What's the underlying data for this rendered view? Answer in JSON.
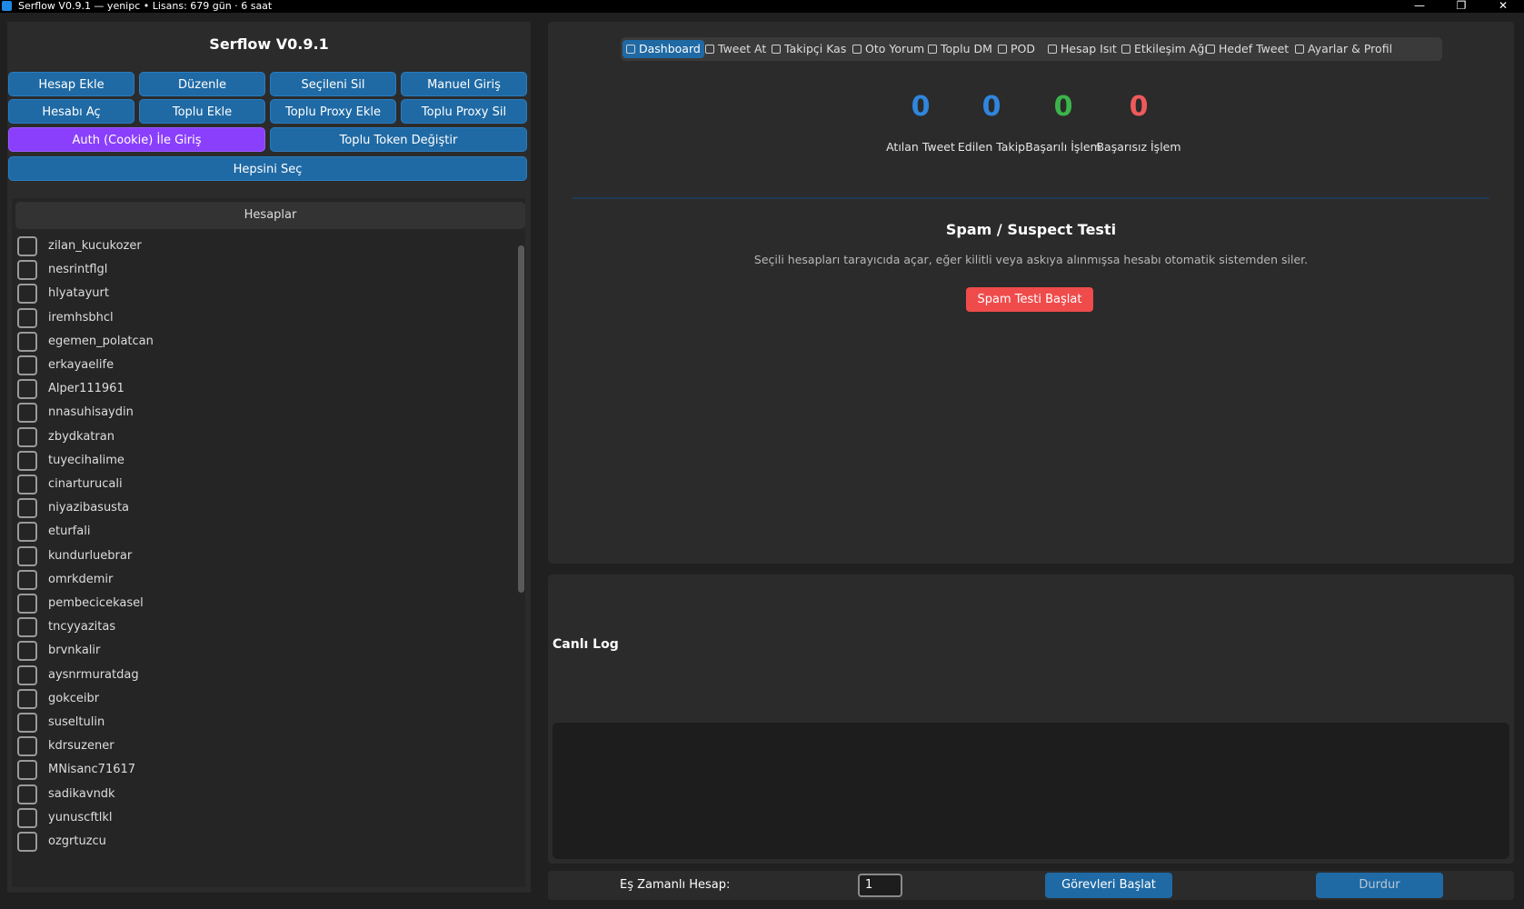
{
  "window": {
    "title": "Serflow V0.9.1 — yenipc  •  Lisans: 679 gün · 6 saat",
    "controls": [
      "—",
      "❐",
      "✕"
    ]
  },
  "sidebar": {
    "app_title": "Serflow V0.9.1",
    "buttons": {
      "hesap_ekle": "Hesap Ekle",
      "duzenle": "Düzenle",
      "secileni_sil": "Seçileni Sil",
      "manuel_giris": "Manuel Giriş",
      "hesabi_ac": "Hesabı Aç",
      "toplu_ekle": "Toplu Ekle",
      "toplu_proxy_ekle": "Toplu Proxy Ekle",
      "toplu_proxy_sil": "Toplu Proxy Sil",
      "auth_giris": "Auth (Cookie) İle Giriş",
      "toplu_token": "Toplu Token Değiştir",
      "hepsini_sec": "Hepsini Seç"
    },
    "accounts_header": "Hesaplar",
    "accounts": [
      "zilan_kucukozer",
      "nesrintflgl",
      "hlyatayurt",
      "iremhsbhcl",
      "egemen_polatcan",
      "erkayaelife",
      "Alper111961",
      "nnasuhisaydin",
      "zbydkatran",
      "tuyecihalime",
      "cinarturucali",
      "niyazibasusta",
      "eturfali",
      "kundurluebrar",
      "omrkdemir",
      "pembecicekasel",
      "tncyyazitas",
      "brvnkalir",
      "aysnrmuratdag",
      "gokceibr",
      "suseltulin",
      "kdrsuzener",
      "MNisanc71617",
      "sadikavndk",
      "yunuscftlkl",
      "ozgrtuzcu"
    ]
  },
  "tabs": [
    {
      "label": "Dashboard",
      "icon": "dashboard-icon",
      "active": true
    },
    {
      "label": "Tweet At",
      "icon": "megaphone-icon"
    },
    {
      "label": "Takipçi Kas",
      "icon": "target-icon"
    },
    {
      "label": "Oto Yorum",
      "icon": "comment-icon"
    },
    {
      "label": "Toplu DM",
      "icon": "inbox-icon"
    },
    {
      "label": "POD",
      "icon": "lightning-icon"
    },
    {
      "label": "Hesap Isıt",
      "icon": "flame-icon"
    },
    {
      "label": "Etkileşim Ağı",
      "icon": "heart-icon"
    },
    {
      "label": "Hedef Tweet",
      "icon": "target-icon"
    },
    {
      "label": "Ayarlar & Profil",
      "icon": "gear-icon"
    }
  ],
  "stats": [
    {
      "value": "0",
      "label": "Atılan Tweet",
      "color": "#2f86dd"
    },
    {
      "value": "0",
      "label": "Edilen Takip",
      "color": "#2f86dd"
    },
    {
      "value": "0",
      "label": "Başarılı İşlem",
      "color": "#3bb44a"
    },
    {
      "value": "0",
      "label": "Başarısız İşlem",
      "color": "#ef5a5a"
    }
  ],
  "spam": {
    "title": "Spam / Suspect Testi",
    "description": "Seçili hesapları tarayıcıda açar, eğer kilitli veya askıya alınmışsa hesabı otomatik sistemden siler.",
    "button": "Spam Testi Başlat"
  },
  "log": {
    "title": "Canlı Log"
  },
  "footer": {
    "concurrent_label": "Eş Zamanlı Hesap:",
    "concurrent_value": "1",
    "start_button": "Görevleri Başlat",
    "stop_button": "Durdur"
  }
}
